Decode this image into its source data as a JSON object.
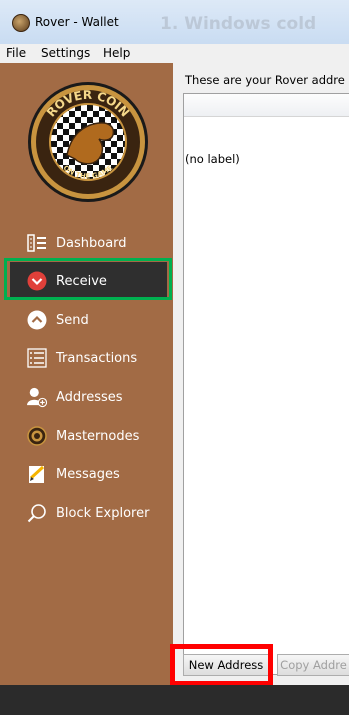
{
  "window": {
    "title": "Rover - Wallet",
    "background_title": "1. Windows cold"
  },
  "menu": {
    "items": [
      "File",
      "Settings",
      "Help"
    ]
  },
  "sidebar": {
    "logo": {
      "top_text": "ROVER COIN",
      "bottom_text": "ON THE GAME"
    },
    "items": [
      {
        "label": "Dashboard",
        "icon": "dashboard-icon"
      },
      {
        "label": "Receive",
        "icon": "receive-icon",
        "active": true
      },
      {
        "label": "Send",
        "icon": "send-icon"
      },
      {
        "label": "Transactions",
        "icon": "transactions-icon"
      },
      {
        "label": "Addresses",
        "icon": "addresses-icon"
      },
      {
        "label": "Masternodes",
        "icon": "masternodes-icon"
      },
      {
        "label": "Messages",
        "icon": "messages-icon"
      },
      {
        "label": "Block Explorer",
        "icon": "search-icon"
      }
    ]
  },
  "main": {
    "description": "These are your Rover addre",
    "rows": [
      {
        "label": "(no label)"
      }
    ],
    "buttons": {
      "new_address": "New Address",
      "copy_address": "Copy Addre"
    }
  },
  "colors": {
    "sidebar": "#a26b45",
    "active_item": "#2f2f2f",
    "green_highlight": "#00b050",
    "red_highlight": "#ff0000",
    "receive_red": "#e0403a"
  }
}
